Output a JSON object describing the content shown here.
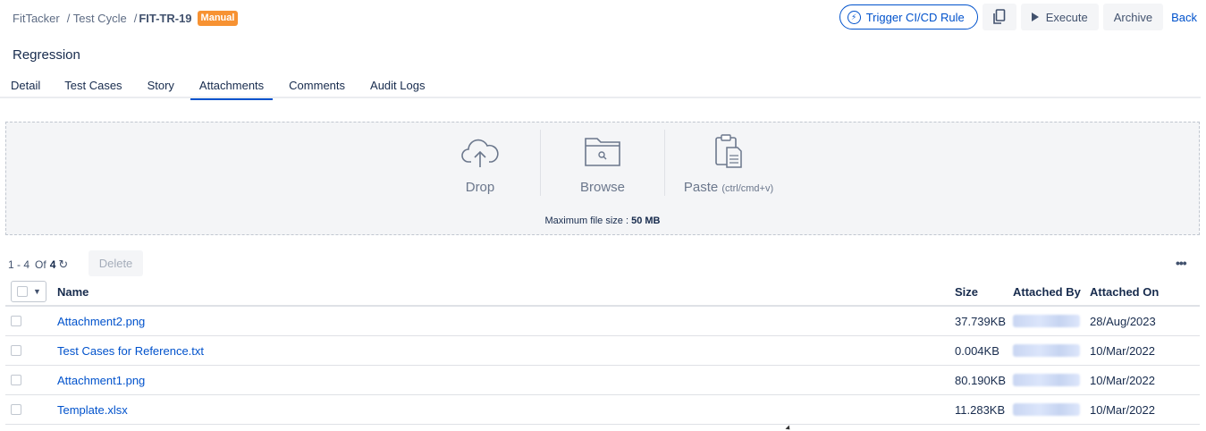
{
  "breadcrumb": {
    "project": "FitTacker",
    "cycle": "/ Test Cycle",
    "sep": "/",
    "key": "FIT-TR-19",
    "badge": "Manual"
  },
  "toolbar": {
    "trigger_label": "Trigger CI/CD Rule",
    "execute_label": "Execute",
    "archive_label": "Archive",
    "back_label": "Back"
  },
  "page_title": "Regression",
  "tabs": [
    {
      "label": "Detail",
      "active": false
    },
    {
      "label": "Test Cases",
      "active": false
    },
    {
      "label": "Story",
      "active": false
    },
    {
      "label": "Attachments",
      "active": true
    },
    {
      "label": "Comments",
      "active": false
    },
    {
      "label": "Audit Logs",
      "active": false
    }
  ],
  "upload": {
    "drop_label": "Drop",
    "browse_label": "Browse",
    "paste_label": "Paste",
    "paste_hint": "(ctrl/cmd+v)",
    "max_size_label": "Maximum file size : ",
    "max_size_value": "50 MB"
  },
  "list": {
    "range": "1 - 4",
    "of_label": "Of",
    "total": "4",
    "delete_label": "Delete",
    "more_label": "•••"
  },
  "table": {
    "headers": {
      "name": "Name",
      "size": "Size",
      "attached_by": "Attached By",
      "attached_on": "Attached On"
    },
    "rows": [
      {
        "name": "Attachment2.png",
        "size": "37.739KB",
        "attached_on": "28/Aug/2023"
      },
      {
        "name": "Test Cases for Reference.txt",
        "size": "0.004KB",
        "attached_on": "10/Mar/2022"
      },
      {
        "name": "Attachment1.png",
        "size": "80.190KB",
        "attached_on": "10/Mar/2022"
      },
      {
        "name": "Template.xlsx",
        "size": "11.283KB",
        "attached_on": "10/Mar/2022"
      }
    ]
  },
  "colors": {
    "accent": "#0052cc",
    "badge": "#f79232"
  }
}
